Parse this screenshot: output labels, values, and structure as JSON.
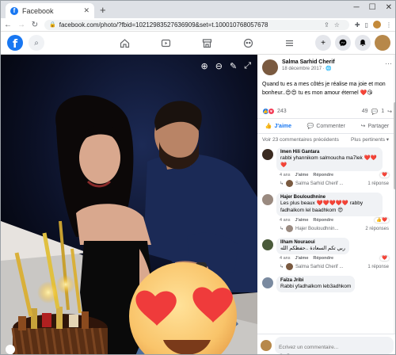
{
  "browser": {
    "tab_title": "Facebook",
    "tab_close": "✕",
    "new_tab": "+",
    "url": "facebook.com/photo/?fbid=10212983527636909&set=t.100010768057678",
    "win_min": "─",
    "win_max": "☐",
    "win_close": "✕"
  },
  "fb": {
    "logo": "f",
    "search_icon": "search-icon",
    "nav": [
      "home-icon",
      "watch-icon",
      "marketplace-icon",
      "groups-icon",
      "menu-icon"
    ],
    "right_buttons": [
      "create-icon",
      "messenger-icon",
      "notifications-icon",
      "profile-avatar"
    ]
  },
  "post": {
    "author": "Salma Sarhid Cherif",
    "date": "18 décembre 2017 · ",
    "text": "Quand tu es a mes côtés je réalise ma joie et mon bonheur..",
    "text_emoji": "😍😍",
    "text2": " tu es mon amour éternel ",
    "text2_emoji": "❤️😘",
    "reaction_count": "243",
    "comment_count": "49",
    "share_count": "1"
  },
  "actions": {
    "like": "J'aime",
    "comment": "Commenter",
    "share": "Partager"
  },
  "comments_header": {
    "previous": "Voir 23 commentaires précédents",
    "sort": "Plus pertinents ▾"
  },
  "comments": [
    {
      "name": "Imen Hili Gantara",
      "text": "rabbi yhannikom salmoucha ma7lek",
      "emoji": "❤️❤️❤️",
      "age": "4 ans",
      "like": "J'aime",
      "reply": "Répondre",
      "replier": "Salma Sarhid Cherif ...",
      "replies": "1 réponse",
      "avatar_color": "#3a2a20"
    },
    {
      "name": "Hajer Bouloudhnine",
      "text": "Les plus beaux ❤️❤️❤️❤️❤️ rabby fadhalkom lel baadhkom ",
      "emoji": "😍",
      "age": "4 ans",
      "like": "J'aime",
      "reply": "Répondre",
      "replier": "Hajer Bouloudhnin...",
      "replies": "2 réponses",
      "avatar_color": "#9a8a80"
    },
    {
      "name": "Ilham Nouraoui",
      "text": "ربي تكم السعادة ..حفظكم الله",
      "emoji": "",
      "age": "4 ans",
      "like": "J'aime",
      "reply": "Répondre",
      "replier": "Salma Sarhid Cherif ...",
      "replies": "1 réponse",
      "avatar_color": "#4a5a3a"
    },
    {
      "name": "Faïza Jribi",
      "text": "Rabbi yfadhalkom leb3adhkom",
      "emoji": "",
      "age": "",
      "like": "",
      "reply": "",
      "replier": "",
      "replies": "",
      "avatar_color": "#7a8aa0"
    }
  ],
  "write": {
    "placeholder": "Écrivez un commentaire..."
  }
}
